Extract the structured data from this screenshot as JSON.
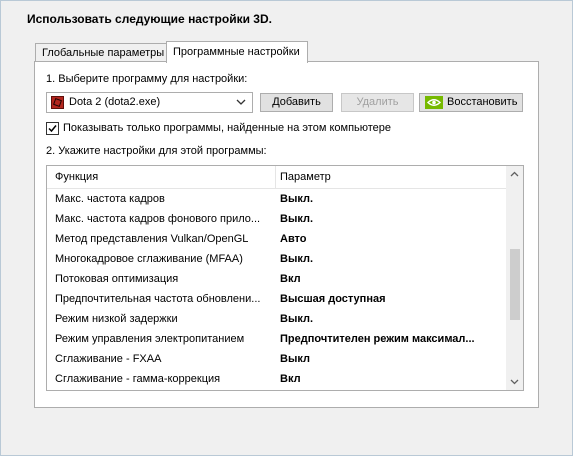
{
  "heading": "Использовать следующие настройки 3D.",
  "tabs": [
    {
      "label": "Глобальные параметры",
      "active": false
    },
    {
      "label": "Программные настройки",
      "active": true
    }
  ],
  "step1": {
    "label": "1. Выберите программу для настройки:",
    "program": {
      "value": "Dota 2 (dota2.exe)",
      "icon": "dota2-app-icon"
    },
    "buttons": {
      "add": "Добавить",
      "remove": "Удалить",
      "restore": "Восстановить"
    }
  },
  "checkbox": {
    "label": "Показывать только программы, найденные на этом компьютере",
    "checked": true
  },
  "step2": {
    "label": "2. Укажите настройки для этой программы:"
  },
  "table": {
    "headers": [
      "Функция",
      "Параметр"
    ],
    "rows": [
      {
        "feature": "Макс. частота кадров",
        "value": "Выкл."
      },
      {
        "feature": "Макс. частота кадров фонового прило...",
        "value": "Выкл."
      },
      {
        "feature": "Метод представления Vulkan/OpenGL",
        "value": "Авто"
      },
      {
        "feature": "Многокадровое сглаживание (MFAA)",
        "value": "Выкл."
      },
      {
        "feature": "Потоковая оптимизация",
        "value": "Вкл"
      },
      {
        "feature": "Предпочтительная частота обновлени...",
        "value": "Высшая доступная"
      },
      {
        "feature": "Режим низкой задержки",
        "value": "Выкл."
      },
      {
        "feature": "Режим управления электропитанием",
        "value": "Предпочтителен режим максимал..."
      },
      {
        "feature": "Сглаживание - FXAA",
        "value": "Выкл"
      },
      {
        "feature": "Сглаживание - гамма-коррекция",
        "value": "Вкл"
      }
    ]
  },
  "colors": {
    "accent_green": "#76b900",
    "border": "#adadad",
    "window_bg": "#f0f0f0"
  }
}
